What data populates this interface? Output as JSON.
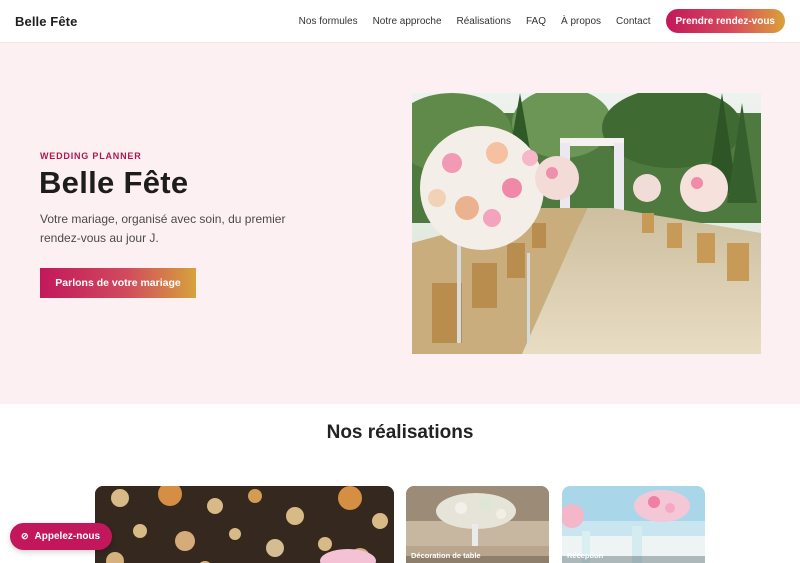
{
  "header": {
    "brand": "Belle Fête",
    "nav": [
      "Nos formules",
      "Notre approche",
      "Réalisations",
      "FAQ",
      "À propos",
      "Contact"
    ],
    "cta": "Prendre rendez-vous"
  },
  "hero": {
    "eyebrow": "WEDDING PLANNER",
    "title": "Belle Fête",
    "text": "Votre mariage, organisé avec soin, du premier rendez-vous au jour J.",
    "button": "Parlons de votre mariage"
  },
  "section": {
    "title": "Nos réalisations",
    "cards": [
      {
        "label": ""
      },
      {
        "label": "Décoration de table"
      },
      {
        "label": "Réception"
      }
    ]
  },
  "floating": {
    "label": "Appelez-nous",
    "icon": "phone-off-icon"
  },
  "colors": {
    "accent": "#c2185b",
    "gold": "#d9a23a",
    "hero_bg": "#fdf0f3"
  }
}
